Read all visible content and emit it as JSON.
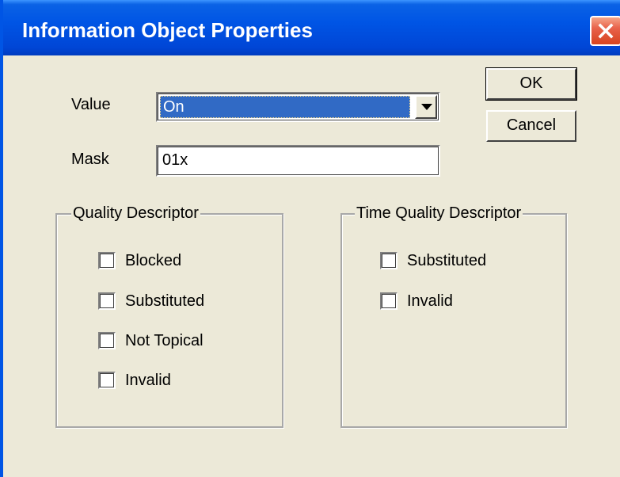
{
  "window": {
    "title": "Information Object Properties"
  },
  "form": {
    "value_label": "Value",
    "value_selected": "On",
    "mask_label": "Mask",
    "mask_value": "01x"
  },
  "buttons": {
    "ok_label": "OK",
    "cancel_label": "Cancel"
  },
  "quality_descriptor": {
    "title": "Quality Descriptor",
    "options": [
      {
        "label": "Blocked",
        "checked": false
      },
      {
        "label": "Substituted",
        "checked": false
      },
      {
        "label": "Not Topical",
        "checked": false
      },
      {
        "label": "Invalid",
        "checked": false
      }
    ]
  },
  "time_quality_descriptor": {
    "title": "Time Quality Descriptor",
    "options": [
      {
        "label": "Substituted",
        "checked": false
      },
      {
        "label": "Invalid",
        "checked": false
      }
    ]
  },
  "icons": {
    "close": "close-icon",
    "dropdown": "chevron-down-icon"
  },
  "colors": {
    "titlebar": "#0055e5",
    "dialog_background": "#ece9d8",
    "selection": "#316ac5",
    "close_button": "#d7431f"
  }
}
